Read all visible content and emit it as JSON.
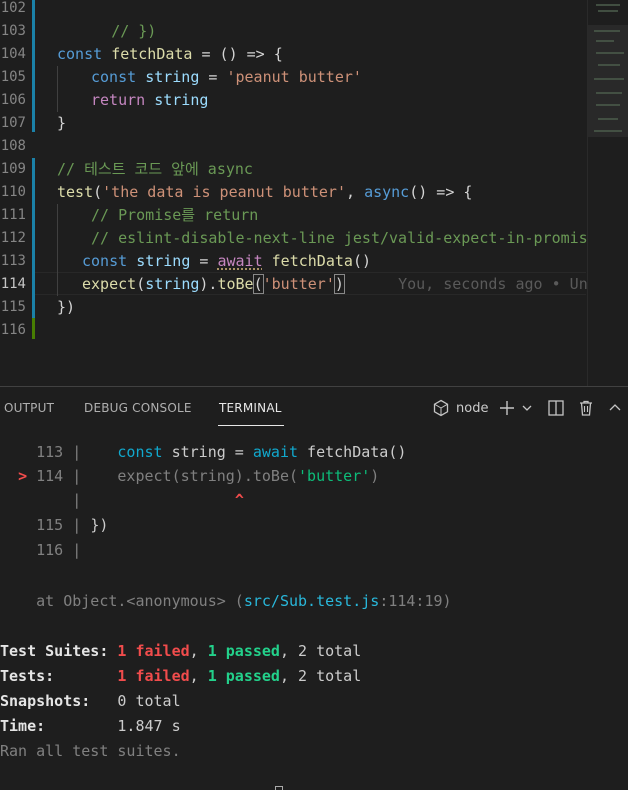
{
  "editor": {
    "line_numbers": [
      "102",
      "103",
      "104",
      "105",
      "106",
      "107",
      "108",
      "109",
      "110",
      "111",
      "112",
      "113",
      "114",
      "115",
      "116"
    ],
    "lines": {
      "l102": {
        "comment": "// })"
      },
      "l104": {
        "kw": "const",
        "name": "fetchData",
        "rest": " = () => {"
      },
      "l105": {
        "kw": "const",
        "name": "string",
        "eq": " = ",
        "str": "'peanut butter'"
      },
      "l106": {
        "kw": "return",
        "name": "string"
      },
      "l107": {
        "text": "}"
      },
      "l109": {
        "comment": "// 테스트 코드 앞에 async"
      },
      "l110": {
        "fn": "test",
        "open": "(",
        "str": "'the data is peanut butter'",
        "comma": ", ",
        "kw": "async",
        "rest": "() => {"
      },
      "l111": {
        "comment": "// Promise를 return"
      },
      "l112": {
        "comment": "// eslint-disable-next-line jest/valid-expect-in-promise"
      },
      "l113": {
        "kw": "const",
        "name": "string",
        "eq": " = ",
        "await": "await",
        "fn": "fetchData",
        "rest": "()"
      },
      "l114": {
        "fn": "expect",
        "open": "(",
        "name": "string",
        "mid": ").",
        "fn2": "toBe",
        "open2": "(",
        "str": "'butter'",
        "close": ")",
        "blame": "You, seconds ago • Uncommitted changes"
      },
      "l115": {
        "text": "})"
      }
    }
  },
  "panel": {
    "tabs": [
      "OUTPUT",
      "DEBUG CONSOLE",
      "TERMINAL"
    ],
    "active_tab": "TERMINAL",
    "shell_label": "node",
    "icons": [
      "node-shell-icon",
      "plus-icon",
      "chevron-down-icon",
      "split-icon",
      "trash-icon",
      "chevron-up-icon"
    ]
  },
  "terminal": {
    "ctx113": {
      "num": "113",
      "sep": " | ",
      "kw": "const",
      "mid": " string = ",
      "await": "await",
      "rest": " fetchData()"
    },
    "ctx114": {
      "marker": ">",
      "num": "114",
      "sep": " | ",
      "pre": "expect(string).toBe(",
      "str": "'butter'",
      "post": ")"
    },
    "caret": {
      "sep": "|",
      "caret": "^"
    },
    "ctx115": {
      "num": "115",
      "sep": " | ",
      "text": "})"
    },
    "ctx116": {
      "num": "116",
      "sep": " |"
    },
    "at": {
      "pre": "at Object.<anonymous> (",
      "path": "src/Sub.test.js",
      "post": ":114:19)"
    },
    "suites": {
      "label": "Test Suites:",
      "failed": "1 failed",
      "c1": ", ",
      "passed": "1 passed",
      "rest": ", 2 total"
    },
    "tests": {
      "label": "Tests:",
      "failed": "1 failed",
      "c1": ", ",
      "passed": "1 passed",
      "rest": ", 2 total"
    },
    "snapshots": {
      "label": "Snapshots:",
      "value": "0 total"
    },
    "time": {
      "label": "Time:",
      "value": "1.847 s"
    },
    "ran": "Ran all test suites."
  },
  "colors": {
    "background": "#1e1e1e",
    "git_modified": "#1b81a8",
    "git_added": "#487e02",
    "failed": "#f14c4c",
    "passed": "#23d18b"
  }
}
